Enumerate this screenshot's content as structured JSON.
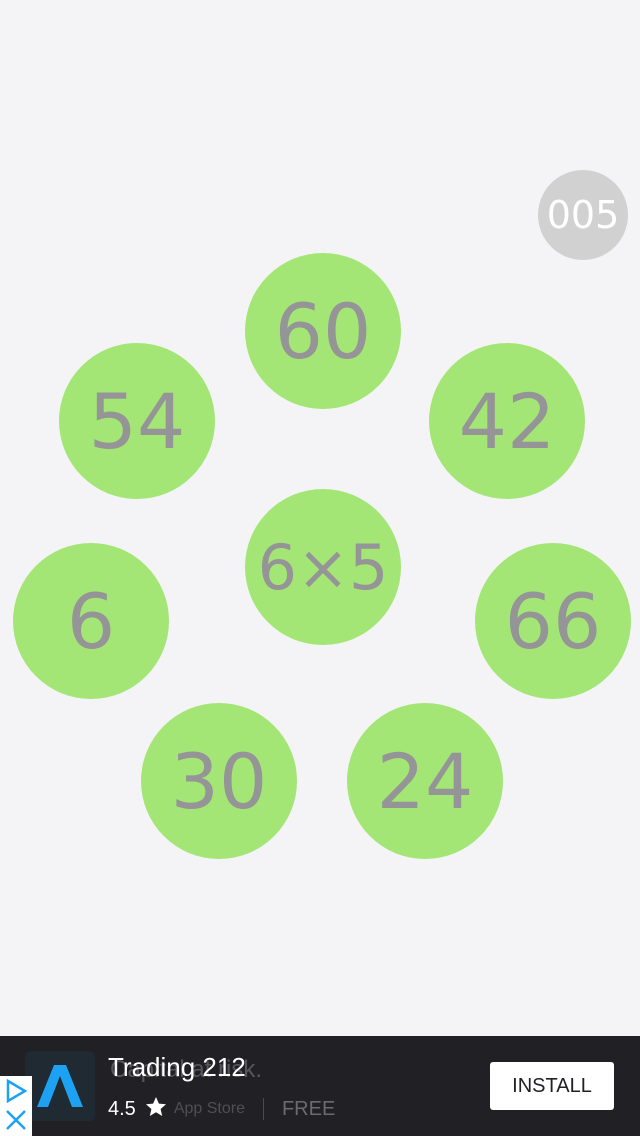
{
  "game": {
    "counter": "005",
    "question": "6×5",
    "answers": [
      "60",
      "42",
      "54",
      "6",
      "66",
      "30",
      "24"
    ]
  },
  "ad": {
    "title": "Trading 212",
    "ghost_text": "Capital at risk.",
    "rating": "4.5",
    "store_ghost": "App Store",
    "price": "FREE",
    "install_label": "INSTALL",
    "brand_color": "#1da1f2",
    "icons": [
      "trading212-logo-icon",
      "star-icon",
      "adchoices-play-icon",
      "close-icon"
    ]
  },
  "colors": {
    "background": "#f4f4f7",
    "bubble": "#a3e675",
    "bubble_text": "#959497",
    "counter_bg": "#d1d1d1",
    "ad_bar": "#212125"
  }
}
